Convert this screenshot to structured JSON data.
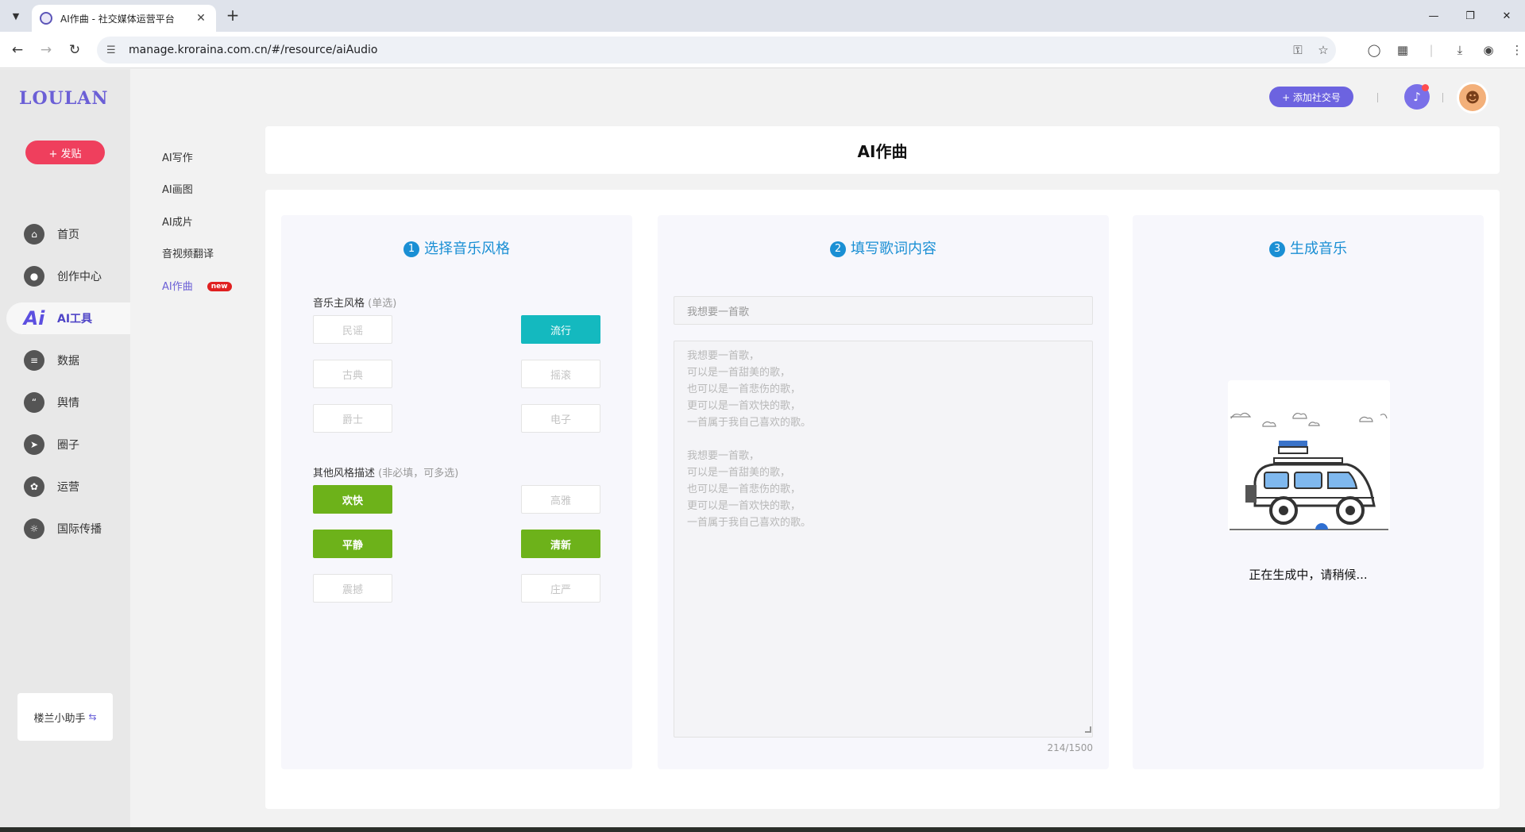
{
  "browser": {
    "tab_title": "AI作曲 - 社交媒体运营平台",
    "url": "manage.kroraina.com.cn/#/resource/aiAudio"
  },
  "brand": {
    "logo": "LOULAN"
  },
  "sidebar": {
    "post_button": "+ 发贴",
    "items": [
      {
        "label": "首页",
        "icon": "home-icon"
      },
      {
        "label": "创作中心",
        "icon": "palette-icon"
      },
      {
        "label": "AI工具",
        "icon": "ai-icon",
        "active": true
      },
      {
        "label": "数据",
        "icon": "database-icon"
      },
      {
        "label": "舆情",
        "icon": "quote-icon"
      },
      {
        "label": "圈子",
        "icon": "compass-icon"
      },
      {
        "label": "运营",
        "icon": "operations-icon"
      },
      {
        "label": "国际传播",
        "icon": "globe-icon"
      }
    ],
    "helper_label": "楼兰小助手"
  },
  "subnav": {
    "items": [
      {
        "label": "AI写作"
      },
      {
        "label": "AI画图"
      },
      {
        "label": "AI成片"
      },
      {
        "label": "音视频翻译"
      },
      {
        "label": "AI作曲",
        "active": true,
        "badge": "new"
      }
    ]
  },
  "header": {
    "add_social_label": "+ 添加社交号"
  },
  "page": {
    "title": "AI作曲"
  },
  "step1": {
    "num": "1",
    "title": "选择音乐风格",
    "main_label": "音乐主风格",
    "main_hint": "(单选)",
    "main_options": [
      {
        "label": "民谣",
        "selected": false
      },
      {
        "label": "流行",
        "selected": true
      },
      {
        "label": "古典",
        "selected": false
      },
      {
        "label": "摇滚",
        "selected": false
      },
      {
        "label": "爵士",
        "selected": false
      },
      {
        "label": "电子",
        "selected": false
      }
    ],
    "other_label": "其他风格描述",
    "other_hint": "(非必填，可多选)",
    "other_options": [
      {
        "label": "欢快",
        "selected": true
      },
      {
        "label": "高雅",
        "selected": false
      },
      {
        "label": "平静",
        "selected": true
      },
      {
        "label": "清新",
        "selected": true
      },
      {
        "label": "震撼",
        "selected": false
      },
      {
        "label": "庄严",
        "selected": false
      }
    ]
  },
  "step2": {
    "num": "2",
    "title": "填写歌词内容",
    "title_placeholder": "我想要一首歌",
    "lyrics": "我想要一首歌，\n可以是一首甜美的歌，\n也可以是一首悲伤的歌，\n更可以是一首欢快的歌，\n一首属于我自己喜欢的歌。\n\n我想要一首歌，\n可以是一首甜美的歌，\n也可以是一首悲伤的歌，\n更可以是一首欢快的歌，\n一首属于我自己喜欢的歌。",
    "counter": "214/1500"
  },
  "step3": {
    "num": "3",
    "title": "生成音乐",
    "status": "正在生成中，请稍候..."
  },
  "colors": {
    "accent": "#6b5fd6",
    "step_blue": "#1a8fd4",
    "teal_selected": "#14b9bf",
    "green_selected": "#6db21a",
    "post_red": "#ef3f5d"
  }
}
